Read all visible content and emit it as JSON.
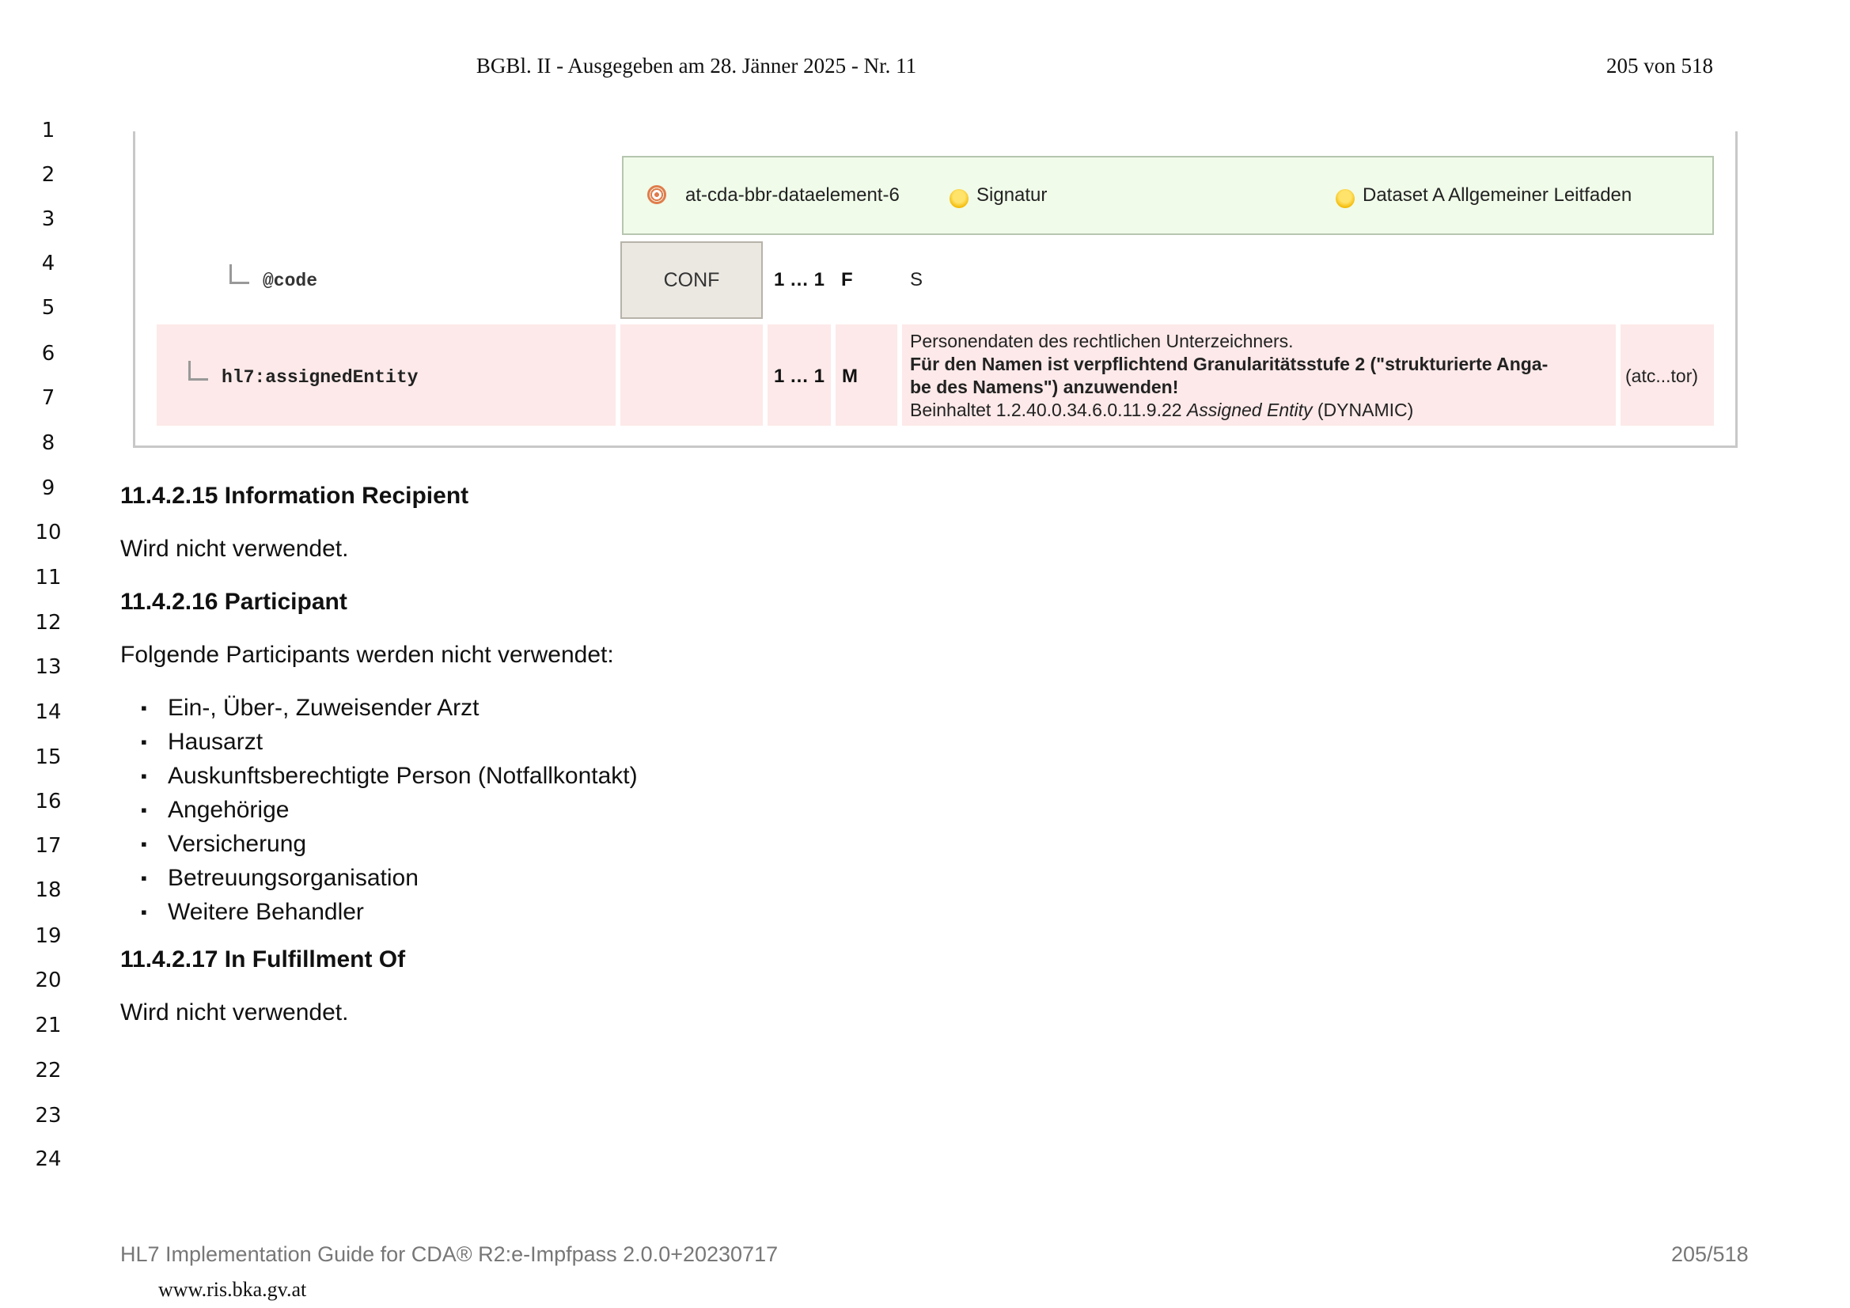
{
  "header": {
    "title": "BGBl. II - Ausgegeben am 28. Jänner 2025 - Nr. 11",
    "page": "205 von 518"
  },
  "line_numbers": [
    "1",
    "2",
    "3",
    "4",
    "5",
    "6",
    "7",
    "8",
    "9",
    "10",
    "11",
    "12",
    "13",
    "14",
    "15",
    "16",
    "17",
    "18",
    "19",
    "20",
    "21",
    "22",
    "23",
    "24"
  ],
  "table": {
    "dataset_row": {
      "element_id": "at-cda-bbr-dataelement-6",
      "concept": "Signatur",
      "dataset": "Dataset A Allgemeiner Leitfaden"
    },
    "code_row": {
      "name": "@code",
      "conf": "CONF",
      "card": "1 … 1",
      "flag": "F",
      "desc": "S"
    },
    "entity_row": {
      "name": "hl7:assignedEntity",
      "card": "1 … 1",
      "flag": "M",
      "desc_line1": "Personendaten des rechtlichen Unterzeichners.",
      "desc_bold1": "Für den Namen ist verpflichtend Granularitätsstufe 2 (\"strukturierte Anga-",
      "desc_bold2": "be des Namens\") anzuwenden!",
      "desc_contains_prefix": "Beinhaltet 1.2.40.0.34.6.0.11.9.22 ",
      "desc_contains_italic": "Assigned Entity",
      "desc_contains_suffix": " (DYNAMIC)",
      "label": "(atc...tor)"
    }
  },
  "sections": {
    "info_recipient": {
      "heading": "11.4.2.15 Information Recipient",
      "text": "Wird nicht verwendet."
    },
    "participant": {
      "heading": "11.4.2.16 Participant",
      "text": "Folgende Participants werden nicht verwendet:",
      "items": [
        "Ein-, Über-, Zuweisender Arzt",
        "Hausarzt",
        "Auskunftsberechtigte Person (Notfallkontakt)",
        "Angehörige",
        "Versicherung",
        "Betreuungsorganisation",
        "Weitere Behandler"
      ]
    },
    "fulfillment": {
      "heading": "11.4.2.17 In Fulfillment Of",
      "text": "Wird nicht verwendet."
    }
  },
  "footer": {
    "guide": "HL7 Implementation Guide for CDA® R2:e-Impfpass 2.0.0+20230717",
    "page": "205/518",
    "url": "www.ris.bka.gv.at"
  },
  "colors": {
    "dataset_bg": "#f0fbe9",
    "required_row_bg": "#fde9e9",
    "conf_bg": "#ebe8e2"
  }
}
